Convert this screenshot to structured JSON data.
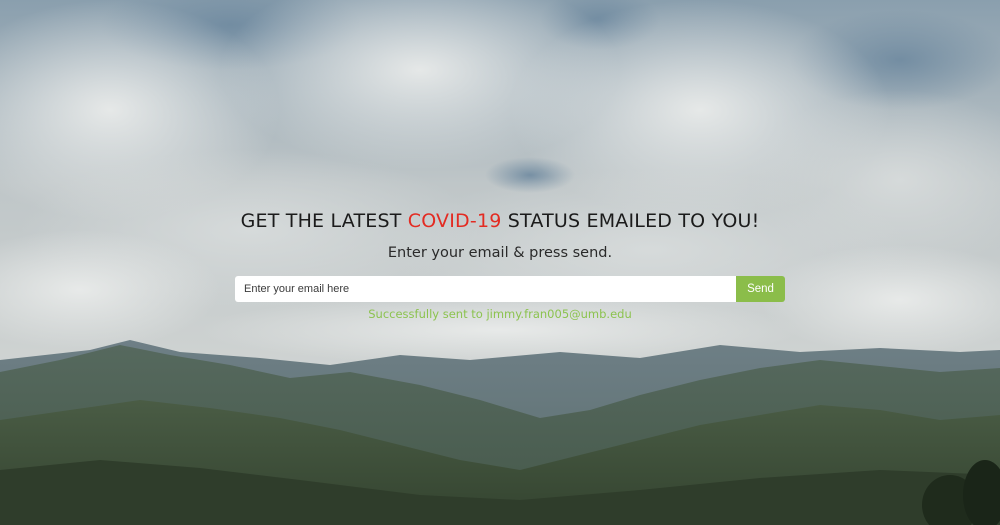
{
  "hero": {
    "headline_pre": "GET THE LATEST ",
    "headline_accent": "COVID-19",
    "headline_post": " STATUS EMAILED TO YOU!",
    "subline": "Enter your email & press send."
  },
  "form": {
    "email_placeholder": "Enter your email here",
    "email_value": "",
    "send_label": "Send"
  },
  "status": {
    "message": "Successfully sent to jimmy.fran005@umb.edu"
  },
  "colors": {
    "accent": "#e32b22",
    "button": "#8bbd4a",
    "success": "#8cc34f"
  },
  "background": {
    "icon": "cloudy-mountains-photo"
  }
}
